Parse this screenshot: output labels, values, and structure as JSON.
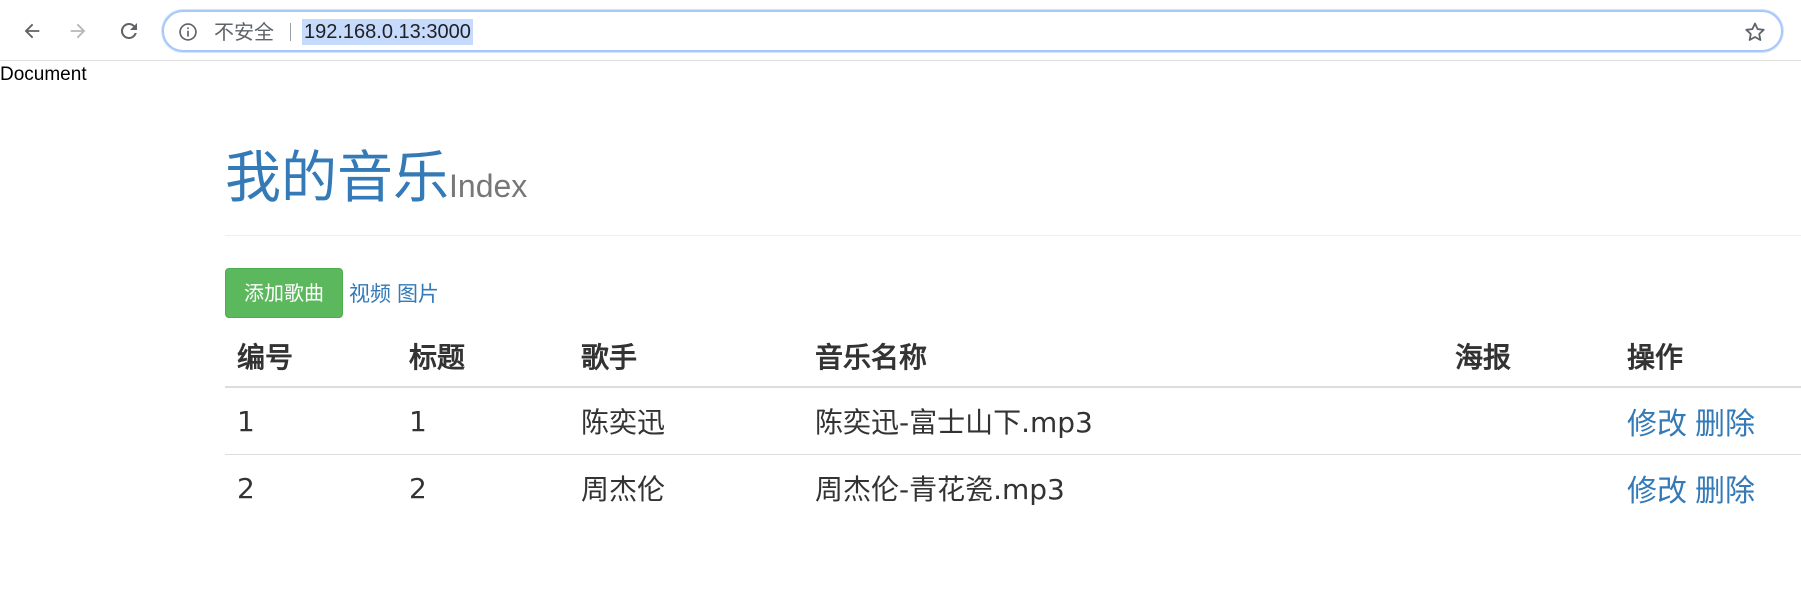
{
  "browser": {
    "security_label": "不安全",
    "url": "192.168.0.13:3000",
    "icons": {
      "back": "arrow-left-icon",
      "forward": "arrow-right-icon",
      "reload": "reload-icon",
      "info": "info-icon",
      "bookmark": "star-icon"
    }
  },
  "document": {
    "title": "Document"
  },
  "header": {
    "brand": "我的音乐",
    "subtitle": "Index"
  },
  "actions": {
    "add_button": "添加歌曲",
    "links": [
      "视频",
      "图片"
    ]
  },
  "table": {
    "columns": [
      "编号",
      "标题",
      "歌手",
      "音乐名称",
      "海报",
      "操作"
    ],
    "rows": [
      {
        "id": "1",
        "title": "1",
        "singer": "陈奕迅",
        "music": "陈奕迅-富士山下.mp3",
        "poster": "",
        "edit": "修改",
        "delete": "删除"
      },
      {
        "id": "2",
        "title": "2",
        "singer": "周杰伦",
        "music": "周杰伦-青花瓷.mp3",
        "poster": "",
        "edit": "修改",
        "delete": "删除"
      }
    ]
  },
  "colors": {
    "brand_blue": "#337ab7",
    "success_green": "#5cb85c",
    "url_highlight": "#c6dafc"
  }
}
